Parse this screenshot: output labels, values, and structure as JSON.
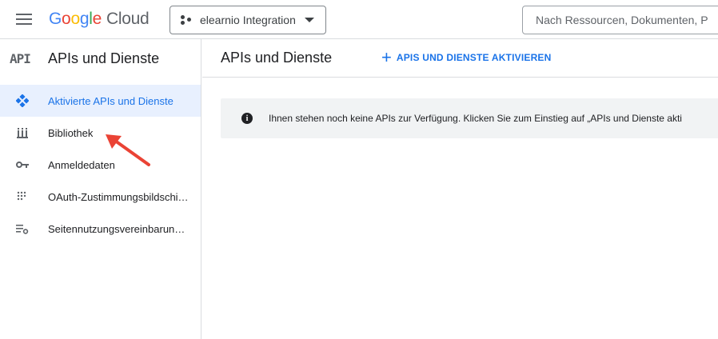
{
  "header": {
    "logo": {
      "google": [
        "G",
        "o",
        "o",
        "g",
        "l",
        "e"
      ],
      "product": "Cloud"
    },
    "project_name": "elearnio Integration",
    "search_placeholder": "Nach Ressourcen, Dokumenten, P"
  },
  "sidebar": {
    "title": "APIs und Dienste",
    "api_icon_text": "API",
    "items": [
      {
        "label": "Aktivierte APIs und Dienste",
        "icon": "api-diamond-icon",
        "active": true
      },
      {
        "label": "Bibliothek",
        "icon": "library-icon",
        "active": false
      },
      {
        "label": "Anmeldedaten",
        "icon": "key-icon",
        "active": false
      },
      {
        "label": "OAuth-Zustimmungsbildschi…",
        "icon": "oauth-dots-icon",
        "active": false
      },
      {
        "label": "Seitennutzungsvereinbarung…",
        "icon": "list-settings-icon",
        "active": false
      }
    ]
  },
  "main": {
    "title": "APIs und Dienste",
    "enable_button_label": "APIS UND DIENSTE AKTIVIEREN",
    "info_message": "Ihnen stehen noch keine APIs zur Verfügung. Klicken Sie zum Einstieg auf „APIs und Dienste akti"
  },
  "colors": {
    "accent": "#1a73e8",
    "active_bg": "#e8f0fe",
    "annotation": "#ea4335"
  }
}
